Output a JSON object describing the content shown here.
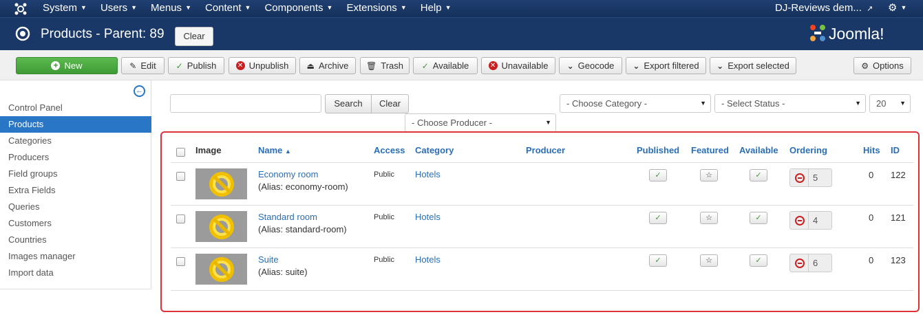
{
  "topbar": {
    "menu": [
      "System",
      "Users",
      "Menus",
      "Content",
      "Components",
      "Extensions",
      "Help"
    ],
    "site_link": "DJ-Reviews dem..."
  },
  "header": {
    "title": "Products - Parent: 89",
    "clear_label": "Clear",
    "brand": "Joomla!"
  },
  "toolbar": {
    "buttons": [
      "New",
      "Edit",
      "Publish",
      "Unpublish",
      "Archive",
      "Trash",
      "Available",
      "Unavailable",
      "Geocode",
      "Export filtered",
      "Export selected"
    ],
    "options_label": "Options"
  },
  "sidebar": {
    "items": [
      "Control Panel",
      "Products",
      "Categories",
      "Producers",
      "Field groups",
      "Extra Fields",
      "Queries",
      "Customers",
      "Countries",
      "Images manager",
      "Import data"
    ],
    "active_item": "Products"
  },
  "filters": {
    "search_value": "",
    "search_label": "Search",
    "clear_label": "Clear",
    "category": "- Choose Category -",
    "status": "- Select Status -",
    "limit": "20",
    "producer": "- Choose Producer -"
  },
  "table": {
    "headers": {
      "image": "Image",
      "name": "Name",
      "access": "Access",
      "category": "Category",
      "producer": "Producer",
      "published": "Published",
      "featured": "Featured",
      "available": "Available",
      "ordering": "Ordering",
      "hits": "Hits",
      "id": "ID"
    },
    "rows": [
      {
        "name": "Economy room",
        "alias": "(Alias: economy-room)",
        "access": "Public",
        "category": "Hotels",
        "ordering": "5",
        "hits": "0",
        "id": "122"
      },
      {
        "name": "Standard room",
        "alias": "(Alias: standard-room)",
        "access": "Public",
        "category": "Hotels",
        "ordering": "4",
        "hits": "0",
        "id": "121"
      },
      {
        "name": "Suite",
        "alias": "(Alias: suite)",
        "access": "Public",
        "category": "Hotels",
        "ordering": "6",
        "hits": "0",
        "id": "123"
      }
    ]
  },
  "colors": {
    "navy": "#1a3867",
    "link": "#2a6eb5",
    "active": "#2a76c6",
    "highlight": "#e0303a",
    "green": "#3f9a35"
  }
}
